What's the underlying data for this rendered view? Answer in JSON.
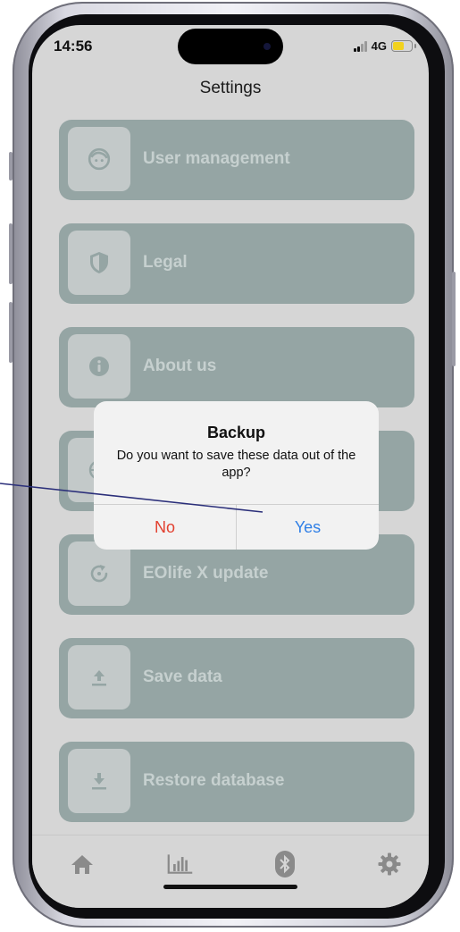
{
  "status": {
    "time": "14:56",
    "network": "4G"
  },
  "header": {
    "title": "Settings"
  },
  "menu": {
    "items": [
      {
        "label": "User management",
        "icon": "face-icon"
      },
      {
        "label": "Legal",
        "icon": "shield-icon"
      },
      {
        "label": "About us",
        "icon": "info-icon"
      },
      {
        "label": "",
        "icon": "language-icon"
      },
      {
        "label": "EOlife X update",
        "icon": "refresh-icon"
      },
      {
        "label": "Save data",
        "icon": "upload-icon"
      },
      {
        "label": "Restore database",
        "icon": "download-icon"
      }
    ]
  },
  "dialog": {
    "title": "Backup",
    "message": "Do you want to save these data out of the app?",
    "no_label": "No",
    "yes_label": "Yes"
  },
  "tabbar": {
    "items": [
      {
        "icon": "home-icon"
      },
      {
        "icon": "bar-chart-icon"
      },
      {
        "icon": "bluetooth-icon"
      },
      {
        "icon": "gear-icon"
      }
    ]
  },
  "colors": {
    "card": "#95a5a4",
    "icon_box": "#c3c9c9",
    "card_label": "#c6d0cf",
    "no_button": "#e2402f",
    "yes_button": "#2f7fe6",
    "annotation_line": "#2b2f7a"
  }
}
